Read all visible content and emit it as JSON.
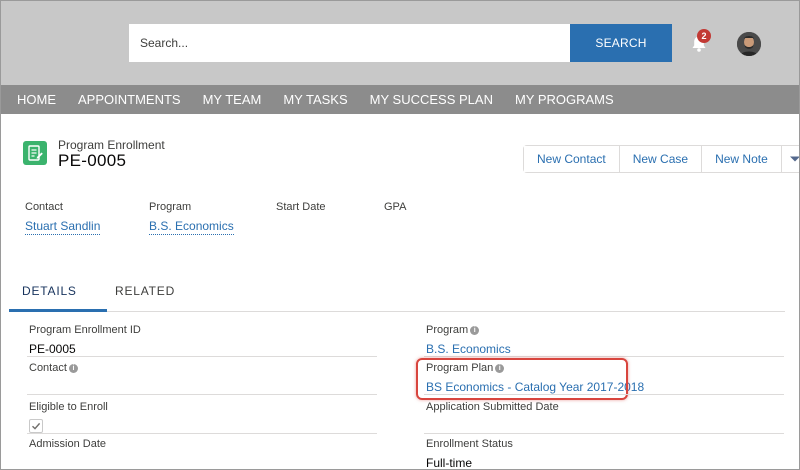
{
  "header": {
    "search_placeholder": "Search...",
    "search_button": "SEARCH",
    "notification_count": "2"
  },
  "nav": {
    "items": [
      "HOME",
      "APPOINTMENTS",
      "MY TEAM",
      "MY TASKS",
      "MY SUCCESS PLAN",
      "MY PROGRAMS"
    ]
  },
  "record": {
    "type": "Program Enrollment",
    "name": "PE-0005",
    "actions": [
      "New Contact",
      "New Case",
      "New Note"
    ]
  },
  "highlights": {
    "contact_label": "Contact",
    "contact_value": "Stuart Sandlin",
    "program_label": "Program",
    "program_value": "B.S. Economics",
    "start_date_label": "Start Date",
    "gpa_label": "GPA"
  },
  "tabs": {
    "details": "DETAILS",
    "related": "RELATED"
  },
  "fields": {
    "program_enrollment_id_label": "Program Enrollment ID",
    "program_enrollment_id_value": "PE-0005",
    "program_label": "Program",
    "program_value": "B.S. Economics",
    "contact_label": "Contact",
    "program_plan_label": "Program Plan",
    "program_plan_value": "BS Economics - Catalog Year 2017-2018",
    "eligible_label": "Eligible to Enroll",
    "eligible_checked": true,
    "application_submitted_label": "Application Submitted Date",
    "admission_date_label": "Admission Date",
    "enrollment_status_label": "Enrollment Status",
    "enrollment_status_value": "Full-time"
  },
  "colors": {
    "accent": "#2a6fb0",
    "record_icon": "#3bb36d",
    "highlight_border": "#d8453e",
    "badge": "#c23934"
  }
}
